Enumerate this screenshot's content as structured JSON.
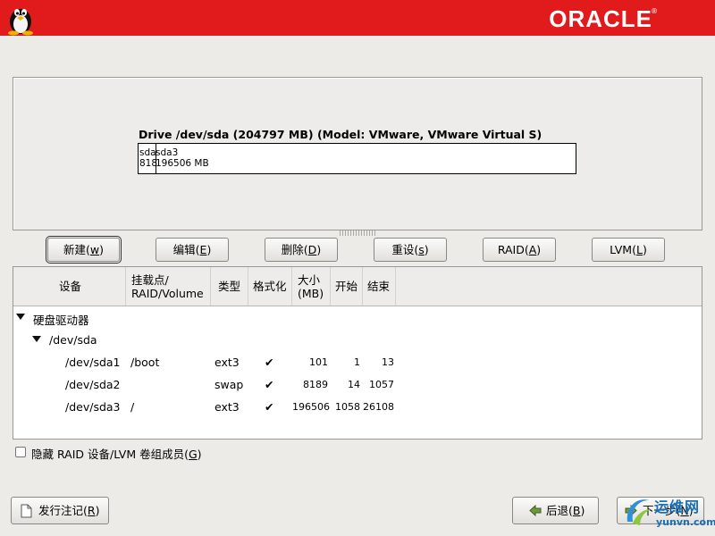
{
  "header": {
    "brand": "ORACLE",
    "brand_mark": "®",
    "left_icon": "tux-penguin-icon"
  },
  "drive": {
    "title": "Drive /dev/sda (204797 MB) (Model: VMware, VMware Virtual S)",
    "segments": [
      {
        "name": "sda",
        "size": "818"
      },
      {
        "name": "sda3",
        "size": "196506 MB"
      }
    ]
  },
  "actions": {
    "new": {
      "label": "新建(",
      "mnemonic": "w",
      "close": ")"
    },
    "edit": {
      "label": "编辑(",
      "mnemonic": "E",
      "close": ")"
    },
    "delete": {
      "label": "删除(",
      "mnemonic": "D",
      "close": ")"
    },
    "reset": {
      "label": "重设(",
      "mnemonic": "s",
      "close": ")"
    },
    "raid": {
      "label": "RAID(",
      "mnemonic": "A",
      "close": ")"
    },
    "lvm": {
      "label": "LVM(",
      "mnemonic": "L",
      "close": ")"
    }
  },
  "table": {
    "headers": {
      "device": "设备",
      "mount_1": "挂载点/",
      "mount_2": "RAID/Volume",
      "type": "类型",
      "format": "格式化",
      "size_1": "大小",
      "size_2": "(MB)",
      "start": "开始",
      "end": "结束"
    },
    "group": "硬盘驱动器",
    "disk": "/dev/sda",
    "rows": [
      {
        "device": "/dev/sda1",
        "mount": "/boot",
        "type": "ext3",
        "format": "✔",
        "size": "101",
        "start": "1",
        "end": "13"
      },
      {
        "device": "/dev/sda2",
        "mount": "",
        "type": "swap",
        "format": "✔",
        "size": "8189",
        "start": "14",
        "end": "1057"
      },
      {
        "device": "/dev/sda3",
        "mount": "/",
        "type": "ext3",
        "format": "✔",
        "size": "196506",
        "start": "1058",
        "end": "26108"
      }
    ]
  },
  "hide_members": {
    "label": "隐藏 RAID 设备/LVM 卷组成员(",
    "mnemonic": "G",
    "close": ")",
    "checked": false
  },
  "footer": {
    "release_notes": {
      "label": "发行注记(",
      "mnemonic": "R",
      "close": ")"
    },
    "back": {
      "label": "后退(",
      "mnemonic": "B",
      "close": ")"
    },
    "next": {
      "label": "下一步(",
      "mnemonic": "N",
      "close": ")"
    }
  },
  "watermark": {
    "title": "运维网",
    "url": "yunvn.com"
  }
}
